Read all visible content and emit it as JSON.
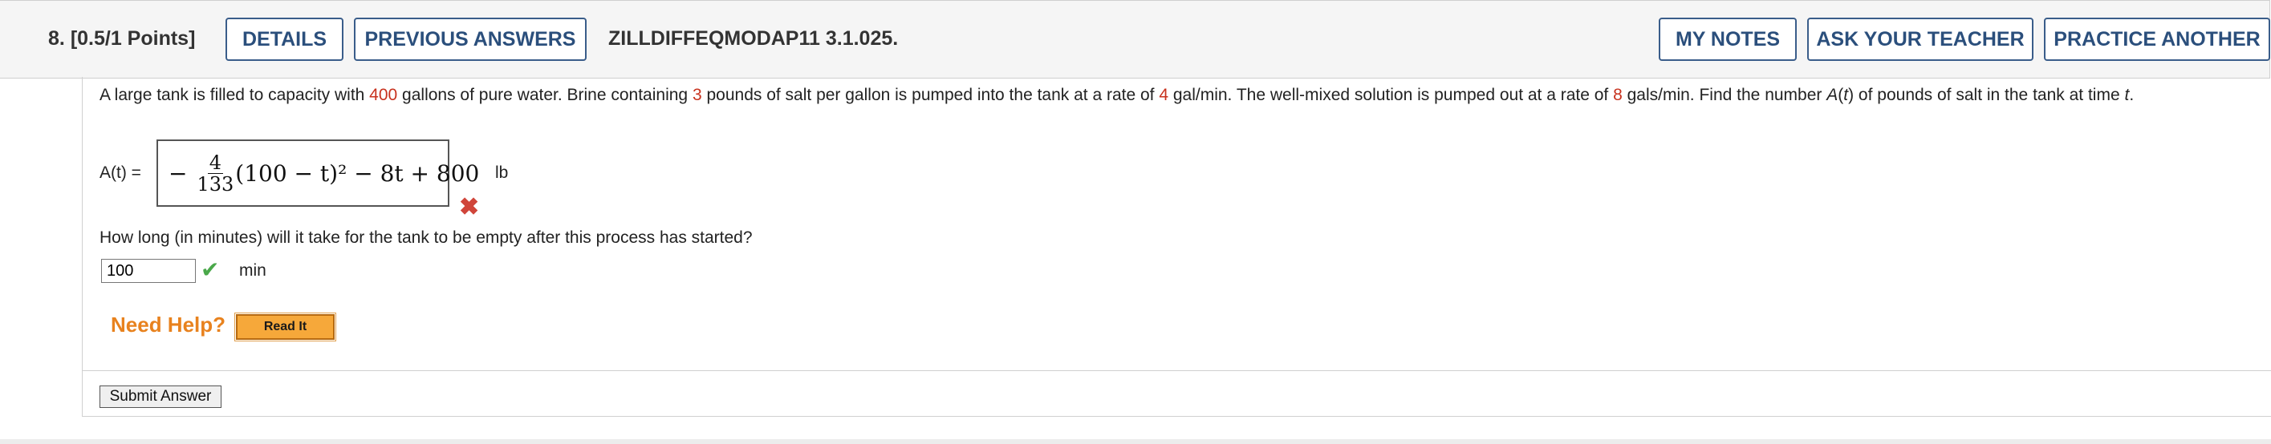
{
  "header": {
    "question_number": "8.",
    "points": "[0.5/1 Points]",
    "details_label": "DETAILS",
    "previous_answers_label": "PREVIOUS ANSWERS",
    "question_id": "ZILLDIFFEQMODAP11 3.1.025.",
    "my_notes_label": "MY NOTES",
    "ask_teacher_label": "ASK YOUR TEACHER",
    "practice_another_label": "PRACTICE ANOTHER"
  },
  "problem": {
    "t1": "A large tank is filled to capacity with ",
    "v1": "400",
    "t2": " gallons of pure water. Brine containing ",
    "v2": "3",
    "t3": " pounds of salt per gallon is pumped into the tank at a rate of ",
    "v3": "4",
    "t4": " gal/min. The well-mixed solution is pumped out at a rate of ",
    "v4": "8",
    "t5": " gals/min. Find the number ",
    "t6": " of pounds of salt in the tank at time "
  },
  "answer1": {
    "label": "A(t) =",
    "minus": "−",
    "frac_num": "4",
    "frac_den": "133",
    "expr_rest": "(100 − t)² − 8t + 800",
    "unit": "lb",
    "status_icon": "x-mark-icon",
    "status_color": "#d0453a"
  },
  "answer2": {
    "question": "How long (in minutes) will it take for the tank to be empty after this process has started?",
    "value": "100",
    "unit": "min",
    "status_icon": "check-icon",
    "status_color": "#4aa84a"
  },
  "help": {
    "label": "Need Help?",
    "read_it_label": "Read It"
  },
  "submit_label": "Submit Answer",
  "colors": {
    "accent": "#2b4f7c",
    "value_red": "#c8321e",
    "help_orange": "#e8821e"
  }
}
